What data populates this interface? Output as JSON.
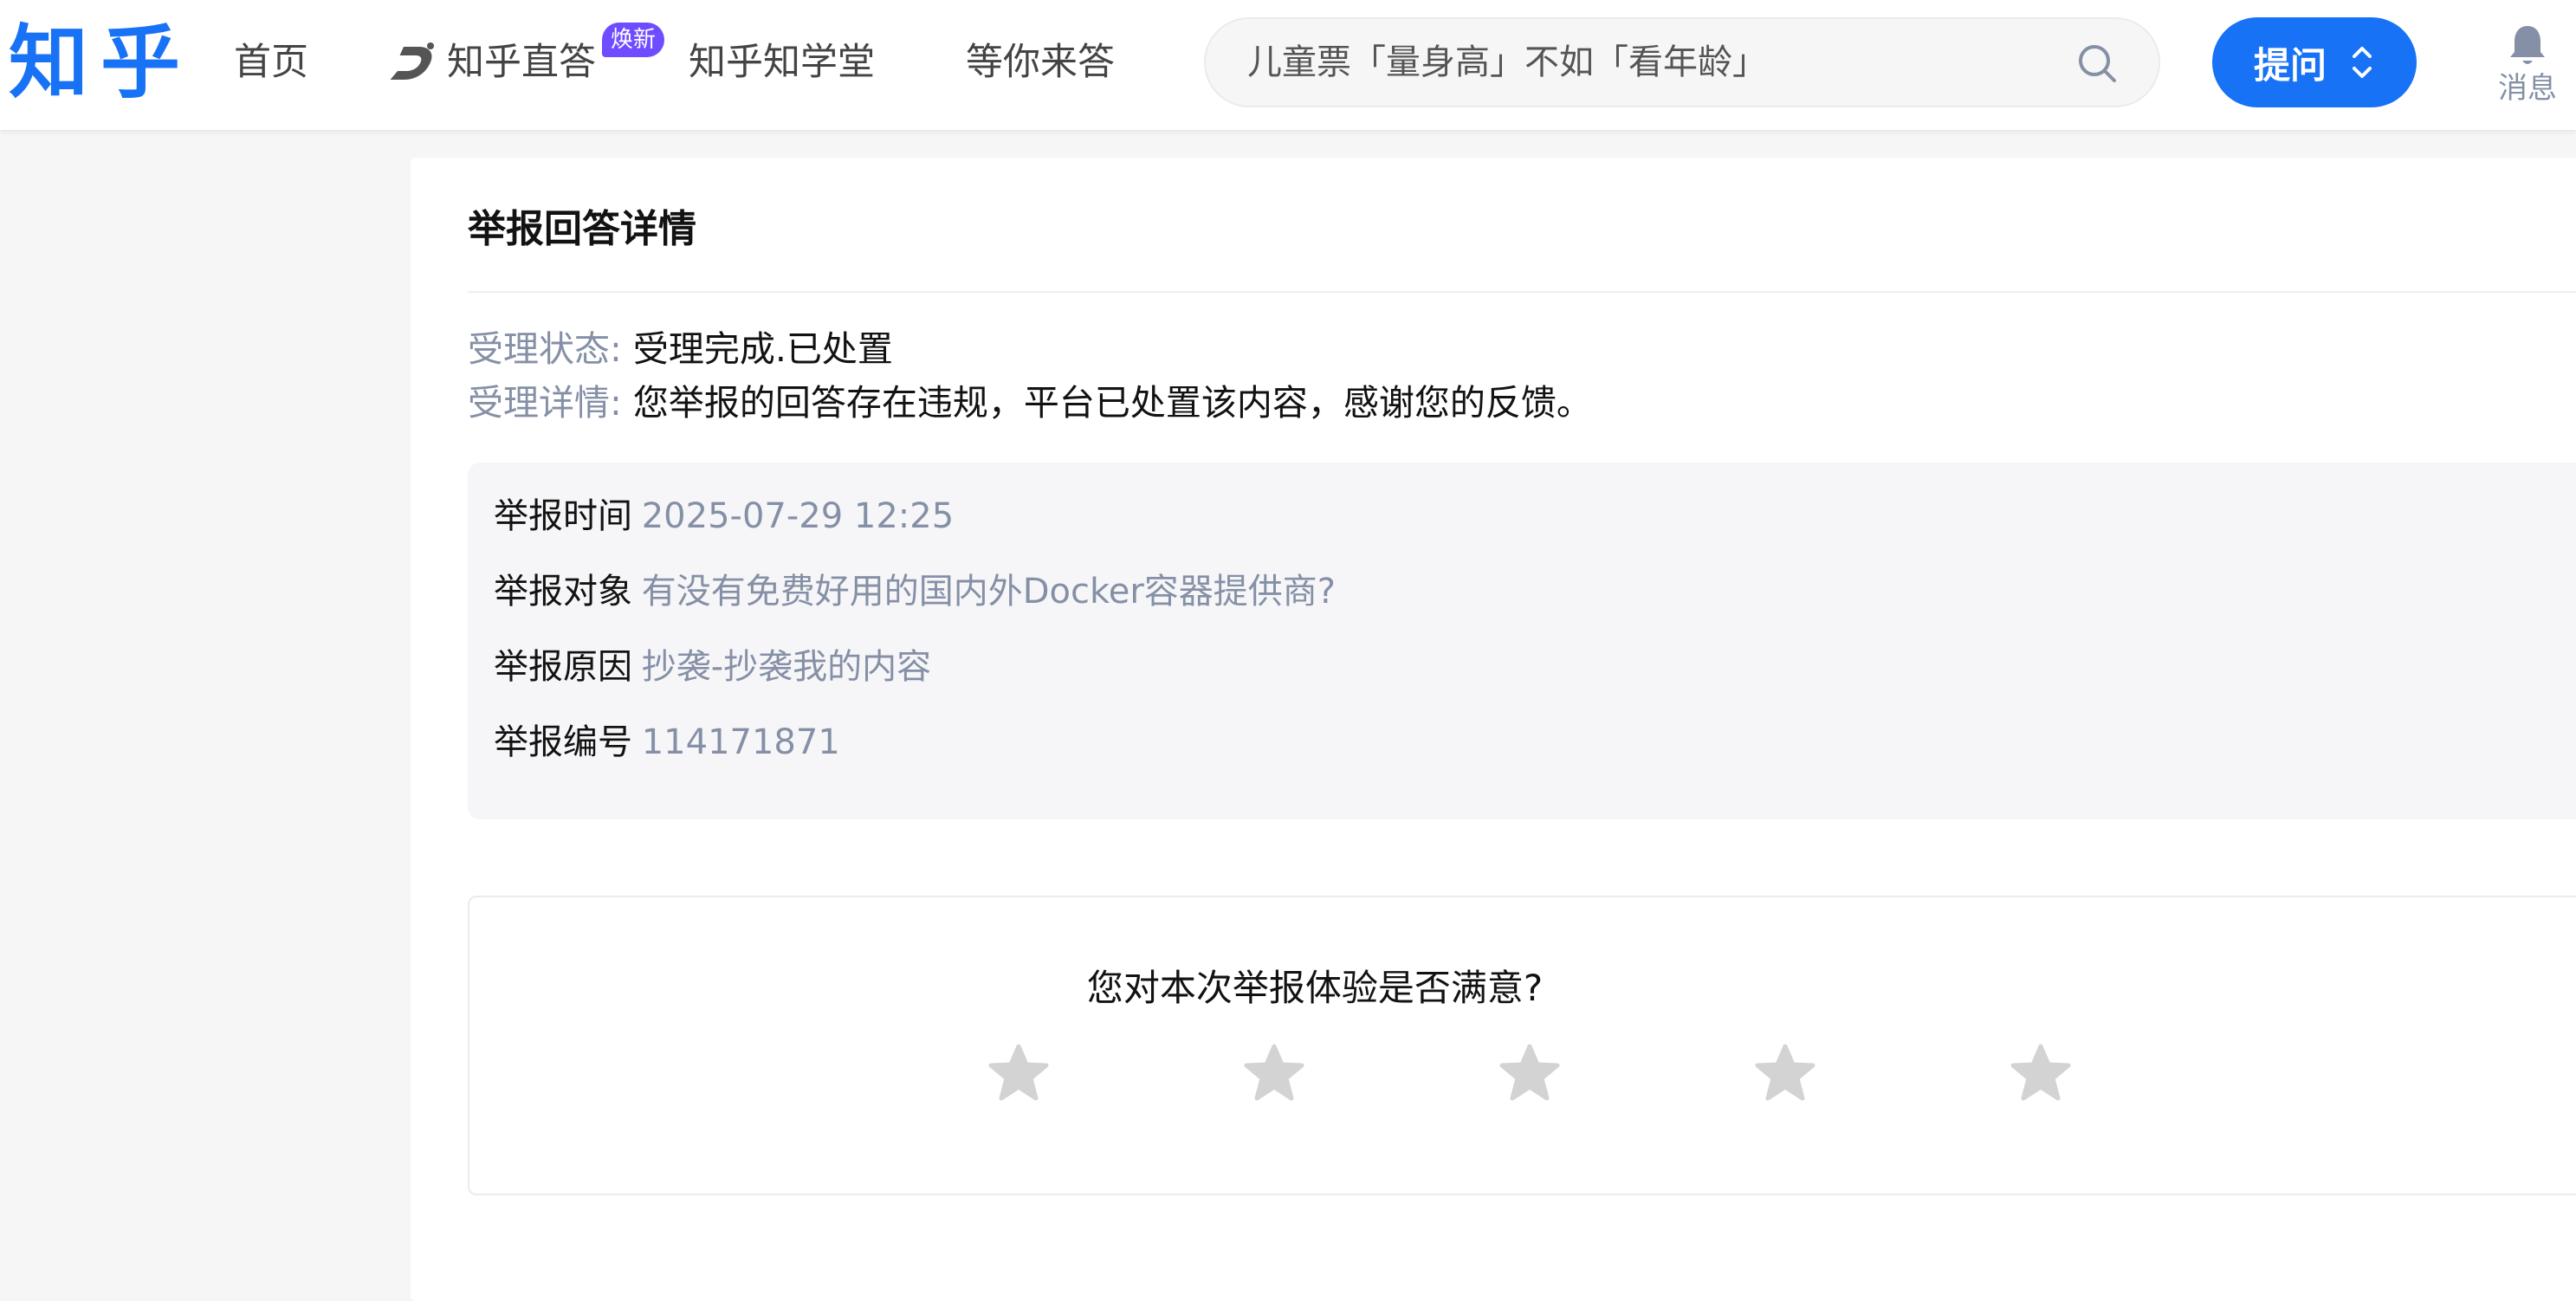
{
  "header": {
    "logo": "知乎",
    "nav": {
      "home": "首页",
      "zhida": "知乎直答",
      "zhida_badge": "焕新",
      "xuetang": "知乎知学堂",
      "wait": "等你来答"
    },
    "search": {
      "placeholder": "儿童票「量身高」不如「看年龄」"
    },
    "ask_button": "提问",
    "messages_label": "消息"
  },
  "report": {
    "title": "举报回答详情",
    "status": {
      "label": "受理状态:",
      "value": "受理完成.已处置"
    },
    "detail": {
      "label": "受理详情:",
      "value": "您举报的回答存在违规，平台已处置该内容，感谢您的反馈。"
    },
    "info": [
      {
        "label": "举报时间",
        "value": "2025-07-29 12:25"
      },
      {
        "label": "举报对象",
        "value": "有没有免费好用的国内外Docker容器提供商?"
      },
      {
        "label": "举报原因",
        "value": "抄袭-抄袭我的内容"
      },
      {
        "label": "举报编号",
        "value": "114171871"
      }
    ],
    "rating": {
      "question": "您对本次举报体验是否满意?",
      "max_stars": 5,
      "selected": 0
    }
  },
  "colors": {
    "brand": "#1772f6",
    "badge": "#6f4cff",
    "muted_text": "#8590a6",
    "star_inactive": "#d3d3d3"
  }
}
